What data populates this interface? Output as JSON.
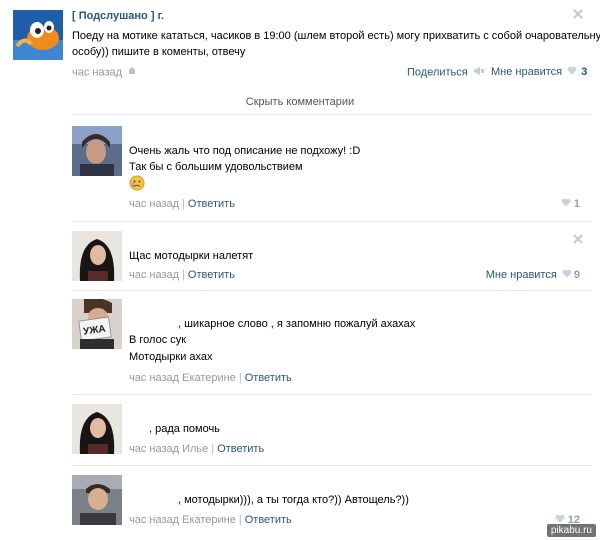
{
  "post": {
    "author": "[ Подслушано ] г.",
    "text_line1": "Поеду на мотике кататься, часиков в 19:00 (шлем второй есть) могу прихватить с собой очаровательную",
    "text_line2": "особу)) пишите в коменты, отвечу",
    "time": "час назад",
    "share_label": "Поделиться",
    "like_label": "Мне нравится",
    "like_count": "3"
  },
  "hide_comments_label": "Скрыть комментарии",
  "comments": [
    {
      "lines": [
        "Очень жаль что под описание не подхожу! :D",
        "Так бы с большим удовольствием"
      ],
      "emoji": "😭",
      "time": "час назад",
      "reply_label": "Ответить",
      "like_count": "1"
    },
    {
      "lines": [
        "Щас мотодырки налетят"
      ],
      "time": "час назад",
      "reply_label": "Ответить",
      "like_label": "Мне нравится",
      "like_count": "9"
    },
    {
      "lines": [
        ", шикарное слово , я запомню пожалуй ахахах",
        "В голос сук",
        "Мотодырки ахах"
      ],
      "time": "час назад Екатерине",
      "reply_label": "Ответить",
      "avatar_text": "УЖА"
    },
    {
      "lines": [
        ", рада помочь"
      ],
      "time": "час назад Илье",
      "reply_label": "Ответить"
    },
    {
      "lines": [
        ", мотодырки))), а ты тогда кто?)) Автощель?))"
      ],
      "time": "час назад Екатерине",
      "reply_label": "Ответить",
      "like_count": "12"
    }
  ],
  "watermark": "pikabu.ru",
  "colors": {
    "link": "#2b587a",
    "muted": "#999999",
    "like_num": "#8fa1b4",
    "divider": "#e7eaed"
  }
}
